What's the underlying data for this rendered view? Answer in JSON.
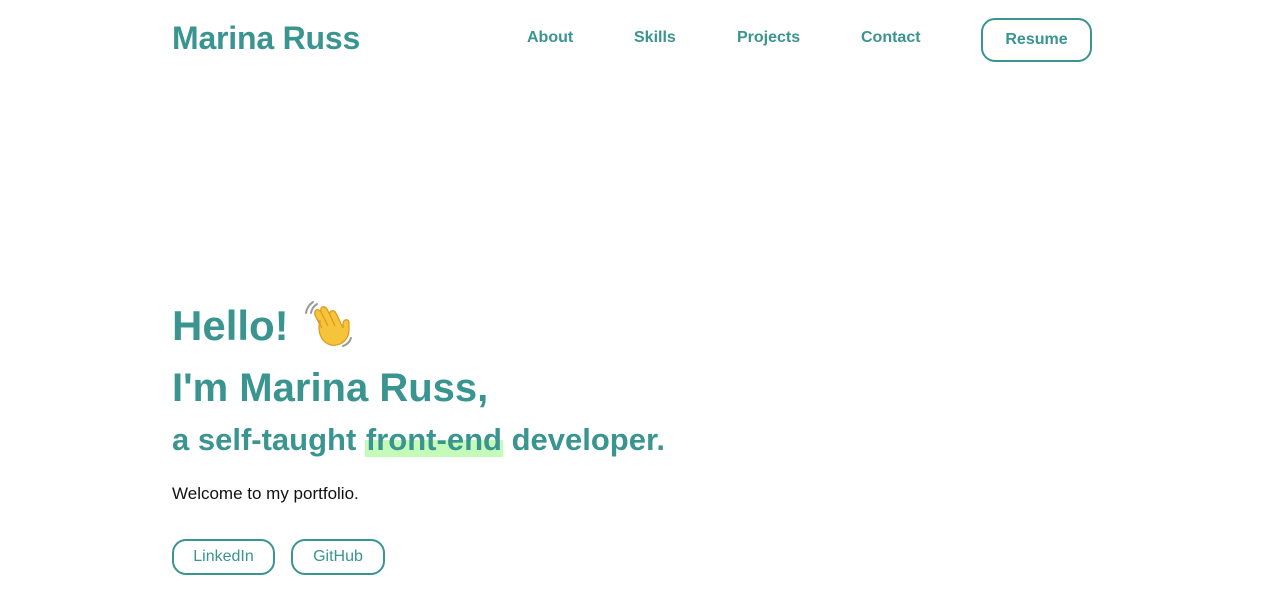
{
  "header": {
    "brand": "Marina Russ",
    "nav": {
      "about": "About",
      "skills": "Skills",
      "projects": "Projects",
      "contact": "Contact"
    },
    "resume_label": "Resume"
  },
  "hero": {
    "hello": "Hello!",
    "wave_icon": "waving-hand-emoji",
    "intro": "I'm Marina Russ,",
    "tagline_prefix": "a self-taught",
    "tagline_highlight": "front-end",
    "tagline_suffix": "developer.",
    "welcome": "Welcome to my portfolio.",
    "buttons": {
      "linkedin": "LinkedIn",
      "github": "GitHub"
    }
  },
  "colors": {
    "accent": "#3a9590",
    "highlight": "#c4fbb9",
    "text": "#111111",
    "background": "#ffffff"
  }
}
